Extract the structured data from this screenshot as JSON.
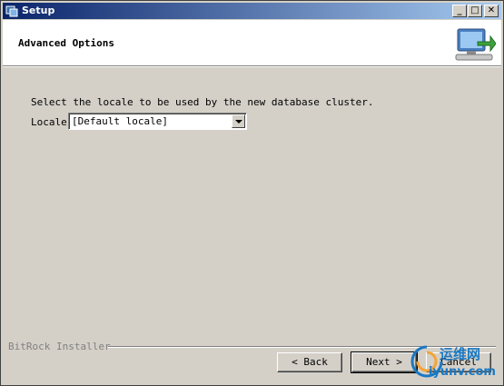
{
  "window": {
    "title": "Setup",
    "controls": {
      "minimize": "_",
      "maximize": "□",
      "close": "✕"
    }
  },
  "header": {
    "title": "Advanced Options",
    "icon": "computer-install-icon"
  },
  "main": {
    "prompt": "Select the locale to be used by the new database cluster.",
    "locale_label": "Locale",
    "locale_value": "[Default locale]"
  },
  "footer": {
    "brand": "BitRock Installer",
    "back_label": "< Back",
    "next_label": "Next >",
    "cancel_label": "Cancel"
  },
  "watermark": {
    "text_cn": "运维网",
    "text_url": "iyunv.com"
  },
  "colors": {
    "titlebar_start": "#0a246a",
    "titlebar_end": "#a6caf0",
    "window_bg": "#d4d0c8",
    "watermark": "#1a78c2"
  }
}
